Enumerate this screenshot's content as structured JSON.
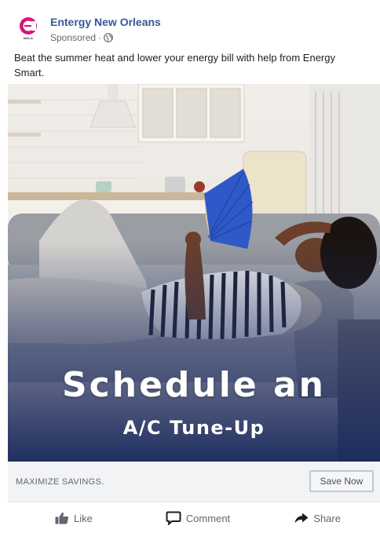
{
  "post": {
    "page_name": "Entergy New Orleans",
    "avatar_tag": "NOLA",
    "sponsored_label": "Sponsored",
    "separator": "·",
    "caption": "Beat the summer heat and lower your energy bill with help from Energy Smart.",
    "icons": [
      "entergy-logo-icon",
      "globe-icon",
      "thumbs-up-icon",
      "comment-icon",
      "share-icon"
    ]
  },
  "ad": {
    "headline": "Schedule an",
    "subheadline": "A/C Tune-Up"
  },
  "cta": {
    "text": "MAXIMIZE SAVINGS.",
    "button_label": "Save Now"
  },
  "actions": {
    "like": "Like",
    "comment": "Comment",
    "share": "Share"
  },
  "colors": {
    "page_name": "#385898",
    "brand_logo": "#d6157a",
    "overlay_navy": "#1e2c5e",
    "fan_blue": "#2f59c9"
  }
}
